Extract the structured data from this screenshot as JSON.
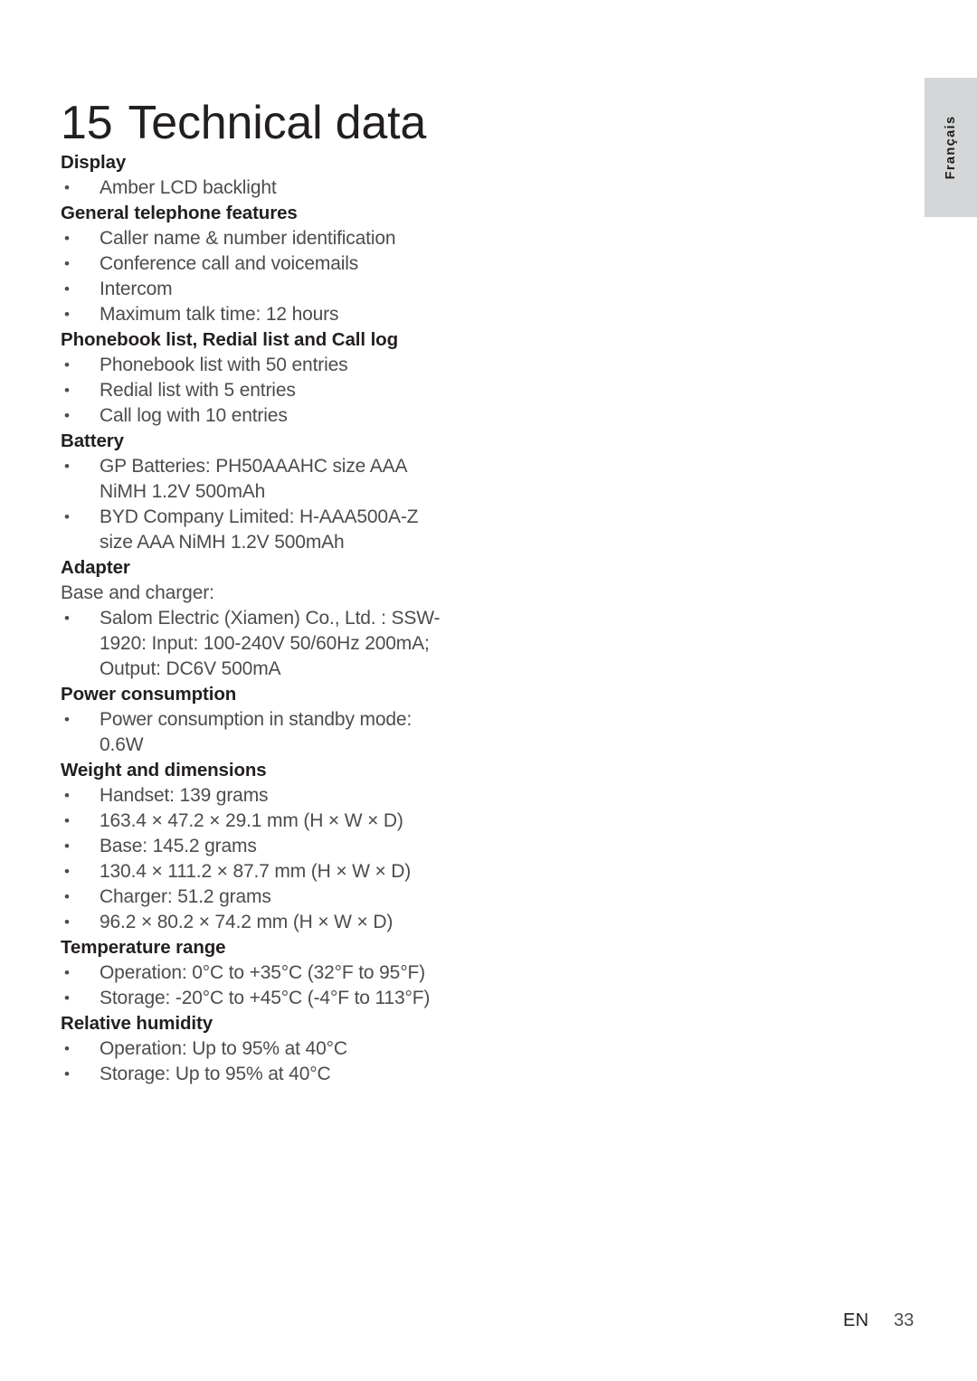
{
  "side_tab": {
    "label": "Français",
    "background": "#d4d6d7",
    "text_color": "#1c1c1c"
  },
  "heading": {
    "number": "15",
    "title": "Technical data"
  },
  "footer": {
    "language": "EN",
    "page_number": "33"
  },
  "colors": {
    "heading": "#231f20",
    "body": "#4c4c4c",
    "page_background": "#ffffff"
  },
  "bullet_glyph": "•",
  "sections": [
    {
      "heading": "Display",
      "lines": [
        {
          "type": "bullet",
          "text": "Amber LCD backlight"
        }
      ]
    },
    {
      "heading": "General telephone features",
      "lines": [
        {
          "type": "bullet",
          "text": "Caller name & number identification"
        },
        {
          "type": "bullet",
          "text": "Conference call and voicemails"
        },
        {
          "type": "bullet",
          "text": "Intercom"
        },
        {
          "type": "bullet",
          "text": "Maximum talk time: 12 hours"
        }
      ]
    },
    {
      "heading": "Phonebook list, Redial list and Call log",
      "lines": [
        {
          "type": "bullet",
          "text": "Phonebook list with 50 entries"
        },
        {
          "type": "bullet",
          "text": "Redial list with 5 entries"
        },
        {
          "type": "bullet",
          "text": "Call log with 10 entries"
        }
      ]
    },
    {
      "heading": "Battery",
      "lines": [
        {
          "type": "bullet",
          "text": "GP Batteries: PH50AAAHC size AAA"
        },
        {
          "type": "continuation",
          "text": "NiMH 1.2V 500mAh"
        },
        {
          "type": "bullet",
          "text": "BYD Company Limited: H-AAA500A-Z"
        },
        {
          "type": "continuation",
          "text": "size AAA NiMH 1.2V 500mAh"
        }
      ]
    },
    {
      "heading": "Adapter",
      "lines": [
        {
          "type": "plain",
          "text": "Base and charger:"
        },
        {
          "type": "bullet",
          "text": "Salom Electric (Xiamen) Co., Ltd. : SSW-"
        },
        {
          "type": "continuation",
          "text": "1920: Input: 100-240V 50/60Hz 200mA;"
        },
        {
          "type": "continuation",
          "text": "Output: DC6V 500mA"
        }
      ]
    },
    {
      "heading": "Power consumption",
      "lines": [
        {
          "type": "bullet",
          "text": "Power consumption in standby mode:"
        },
        {
          "type": "continuation",
          "text": "0.6W"
        }
      ]
    },
    {
      "heading": "Weight and dimensions",
      "lines": [
        {
          "type": "bullet",
          "text": "Handset: 139 grams"
        },
        {
          "type": "bullet",
          "text": "163.4 × 47.2 × 29.1 mm (H × W × D)"
        },
        {
          "type": "bullet",
          "text": "Base: 145.2 grams"
        },
        {
          "type": "bullet",
          "text": "130.4 × 111.2 × 87.7 mm (H × W × D)"
        },
        {
          "type": "bullet",
          "text": "Charger: 51.2 grams"
        },
        {
          "type": "bullet",
          "text": "96.2 × 80.2 × 74.2 mm (H × W × D)"
        }
      ]
    },
    {
      "heading": "Temperature range",
      "lines": [
        {
          "type": "bullet",
          "text": "Operation: 0°C to +35°C (32°F to 95°F)"
        },
        {
          "type": "bullet",
          "text": "Storage: -20°C to +45°C (-4°F to 113°F)"
        }
      ]
    },
    {
      "heading": "Relative humidity",
      "lines": [
        {
          "type": "bullet",
          "text": "Operation: Up to 95% at 40°C"
        },
        {
          "type": "bullet",
          "text": "Storage: Up to 95% at 40°C"
        }
      ]
    }
  ]
}
